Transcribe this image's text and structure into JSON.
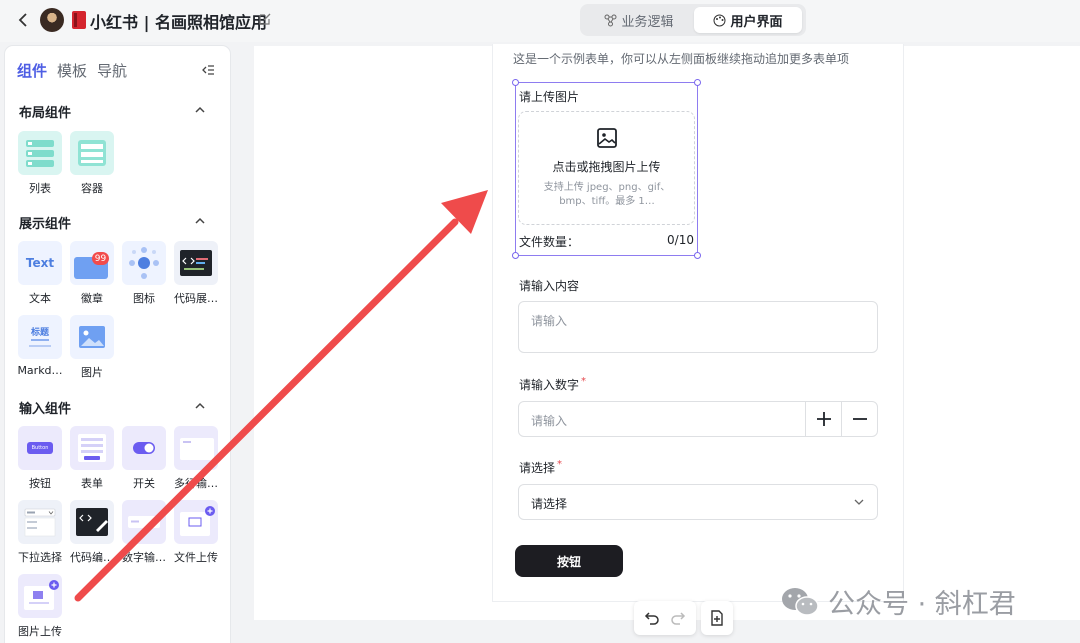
{
  "header": {
    "app_title": "小红书 | 名画照相馆应用",
    "tabs": [
      {
        "label": "业务逻辑"
      },
      {
        "label": "用户界面"
      }
    ],
    "active_tab": "用户界面"
  },
  "left_panel": {
    "tabs": [
      {
        "label": "组件",
        "active": true
      },
      {
        "label": "模板",
        "active": false
      },
      {
        "label": "导航",
        "active": false
      }
    ],
    "sections": [
      {
        "title": "布局组件",
        "items": [
          {
            "label": "列表",
            "icon": "list-icon"
          },
          {
            "label": "容器",
            "icon": "container-icon"
          }
        ]
      },
      {
        "title": "展示组件",
        "items": [
          {
            "label": "文本",
            "icon": "text-icon",
            "tile_text": "Text"
          },
          {
            "label": "徽章",
            "icon": "badge-icon",
            "tile_text": "99"
          },
          {
            "label": "图标",
            "icon": "icons-icon"
          },
          {
            "label": "代码展…",
            "icon": "code-display-icon"
          },
          {
            "label": "Markd…",
            "icon": "markdown-icon",
            "tile_text": "标题"
          },
          {
            "label": "图片",
            "icon": "image-icon"
          }
        ]
      },
      {
        "title": "输入组件",
        "items": [
          {
            "label": "按钮",
            "icon": "button-icon",
            "tile_text": "Button"
          },
          {
            "label": "表单",
            "icon": "form-icon"
          },
          {
            "label": "开关",
            "icon": "switch-icon"
          },
          {
            "label": "多行输…",
            "icon": "textarea-icon"
          },
          {
            "label": "下拉选择",
            "icon": "dropdown-icon"
          },
          {
            "label": "代码编…",
            "icon": "code-editor-icon"
          },
          {
            "label": "数字输…",
            "icon": "number-input-icon"
          },
          {
            "label": "文件上传",
            "icon": "file-upload-icon"
          },
          {
            "label": "图片上传",
            "icon": "image-upload-icon"
          }
        ]
      }
    ]
  },
  "form": {
    "hint": "这是一个示例表单，你可以从左侧面板继续拖动追加更多表单项",
    "upload": {
      "label": "请上传图片",
      "drop_title": "点击或拖拽图片上传",
      "drop_sub": "支持上传 jpeg、png、gif、bmp、tiff。最多 1…",
      "count_label": "文件数量：",
      "count_value": "0/10"
    },
    "content": {
      "label": "请输入内容",
      "placeholder": "请输入"
    },
    "number": {
      "label": "请输入数字",
      "placeholder": "请输入",
      "required": true
    },
    "select": {
      "label": "请选择",
      "value": "请选择",
      "required": true
    },
    "button_label": "按钮"
  },
  "watermark": "公众号 · 斜杠君",
  "colors": {
    "accent": "#4e5ee4",
    "arrow": "#ef4b4b",
    "selection": "#8e7cf0",
    "dark_button": "#1d1d22"
  }
}
